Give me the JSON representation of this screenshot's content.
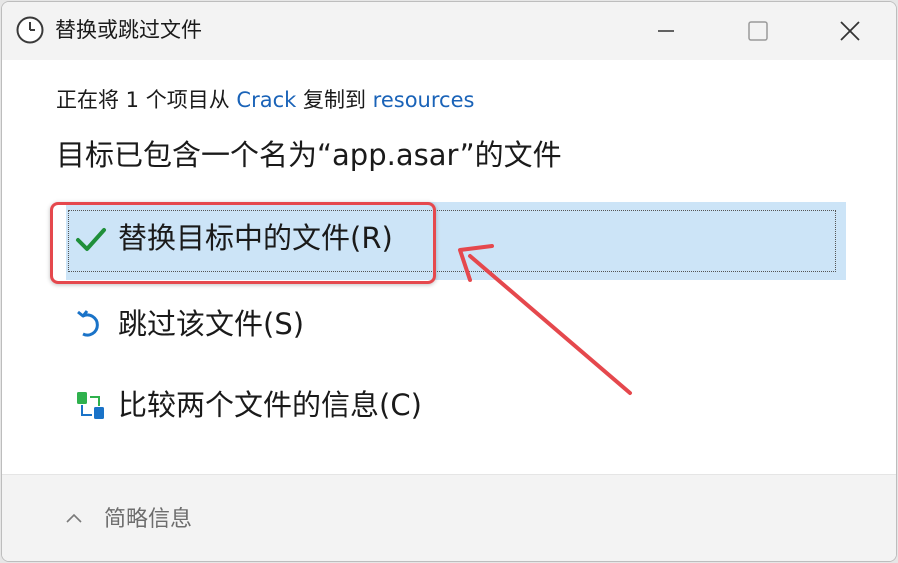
{
  "window": {
    "title": "替换或跳过文件",
    "controls": {
      "minimize": "minimize-icon",
      "maximize": "maximize-icon",
      "close": "close-icon"
    }
  },
  "copy_status": {
    "prefix": "正在将 1 个项目从",
    "source": "Crack",
    "middle": "复制到",
    "destination": "resources"
  },
  "heading": "目标已包含一个名为“app.asar”的文件",
  "options": [
    {
      "label": "替换目标中的文件(R)",
      "icon": "checkmark-icon",
      "selected": true
    },
    {
      "label": "跳过该文件(S)",
      "icon": "undo-arrow-icon",
      "selected": false
    },
    {
      "label": "比较两个文件的信息(C)",
      "icon": "compare-files-icon",
      "selected": false
    }
  ],
  "footer": {
    "label": "简略信息",
    "icon": "chevron-up-icon"
  },
  "colors": {
    "accent_link": "#1a63b8",
    "selected_bg": "#cce4f7",
    "annotation_red": "#e5484d",
    "check_green": "#1f8f3a",
    "icon_blue": "#1a73c8"
  }
}
